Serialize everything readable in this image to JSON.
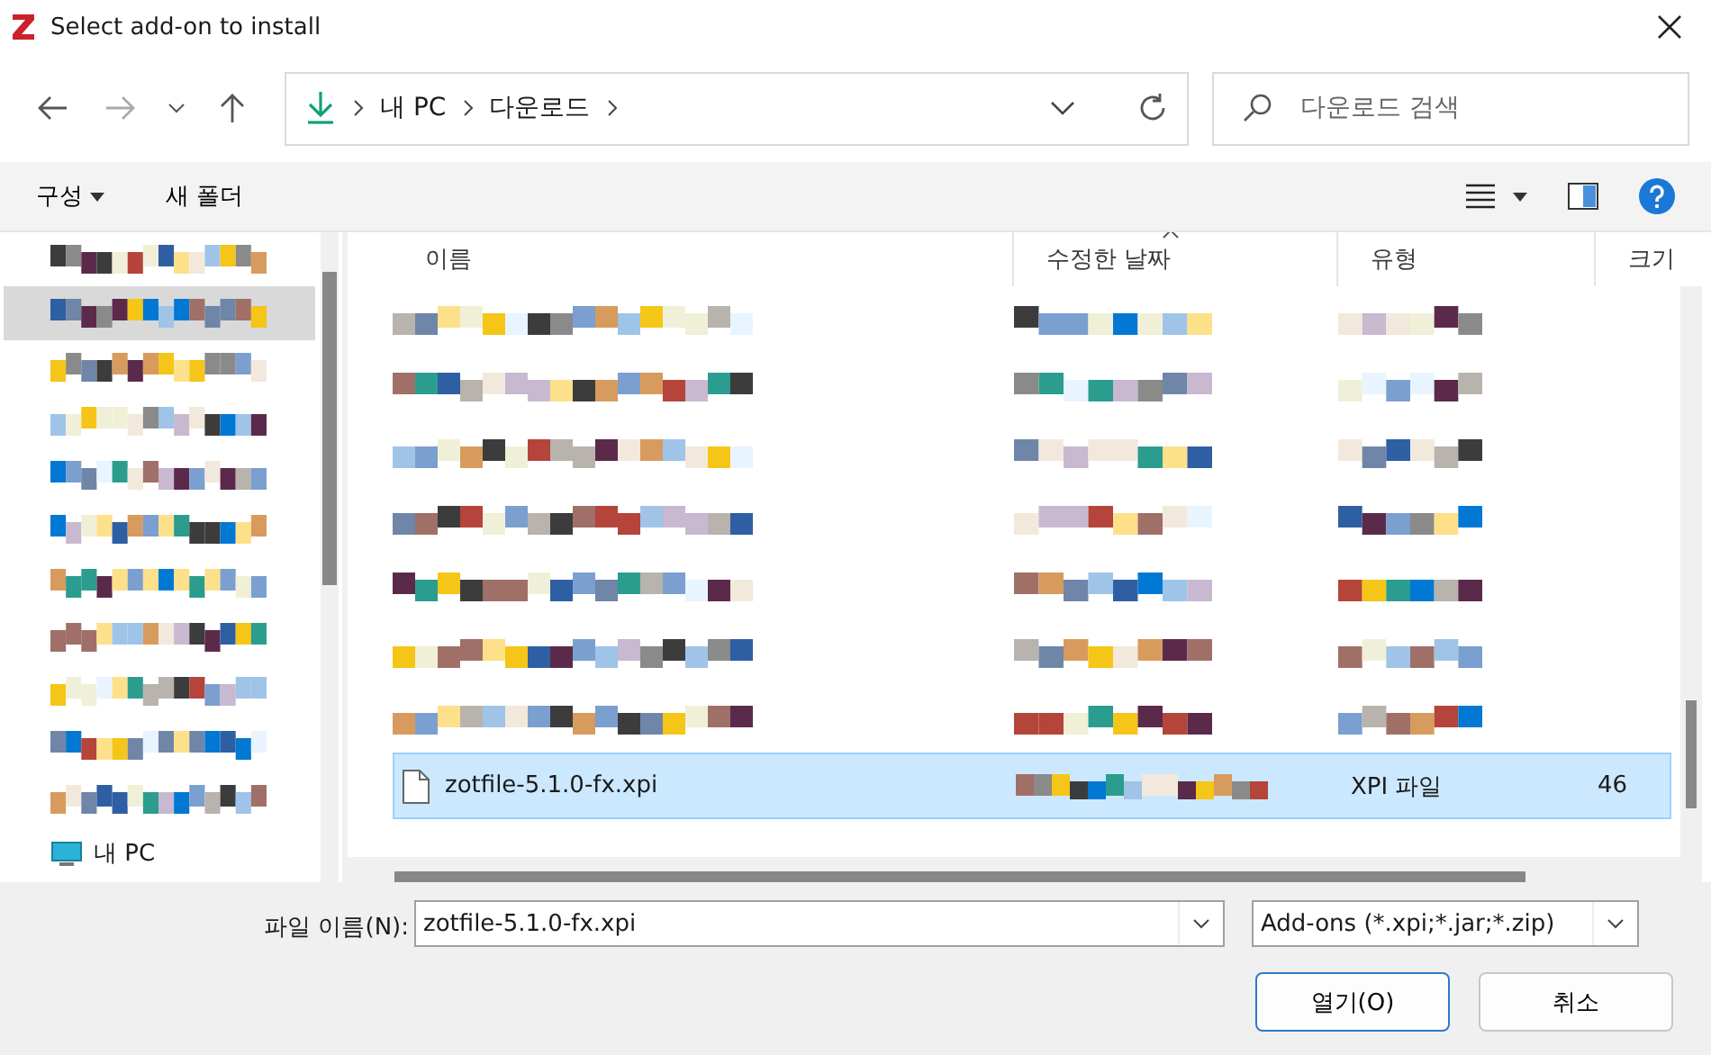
{
  "window": {
    "title": "Select add-on to install"
  },
  "address": {
    "path": [
      "내 PC",
      "다운로드"
    ]
  },
  "search": {
    "placeholder": "다운로드 검색"
  },
  "toolbar": {
    "organize": "구성",
    "new_folder": "새 폴더"
  },
  "sidebar": {
    "items": [
      {
        "kind": "redacted",
        "selected": false
      },
      {
        "kind": "redacted",
        "selected": true
      },
      {
        "kind": "redacted",
        "selected": false
      },
      {
        "kind": "redacted",
        "selected": false
      },
      {
        "kind": "redacted",
        "selected": false
      },
      {
        "kind": "redacted",
        "selected": false
      },
      {
        "kind": "redacted",
        "selected": false
      },
      {
        "kind": "redacted",
        "selected": false
      },
      {
        "kind": "redacted",
        "selected": false
      },
      {
        "kind": "redacted",
        "selected": false
      },
      {
        "kind": "redacted",
        "selected": false
      },
      {
        "kind": "pc",
        "label": "내 PC",
        "selected": false
      }
    ]
  },
  "table": {
    "columns": [
      "이름",
      "수정한 날짜",
      "유형",
      "크기"
    ],
    "rows": [
      {
        "kind": "redacted",
        "selected": false
      },
      {
        "kind": "redacted",
        "selected": false
      },
      {
        "kind": "redacted",
        "selected": false
      },
      {
        "kind": "redacted",
        "selected": false
      },
      {
        "kind": "redacted",
        "selected": false
      },
      {
        "kind": "redacted",
        "selected": false
      },
      {
        "kind": "redacted",
        "selected": false
      },
      {
        "kind": "file",
        "name": "zotfile-5.1.0-fx.xpi",
        "type": "XPI 파일",
        "size": "46",
        "selected": true
      }
    ]
  },
  "footer": {
    "filename_label": "파일 이름(N):",
    "filename": "zotfile-5.1.0-fx.xpi",
    "filter": "Add-ons (*.xpi;*.jar;*.zip)",
    "buttons": [
      "열기(O)",
      "취소"
    ]
  }
}
